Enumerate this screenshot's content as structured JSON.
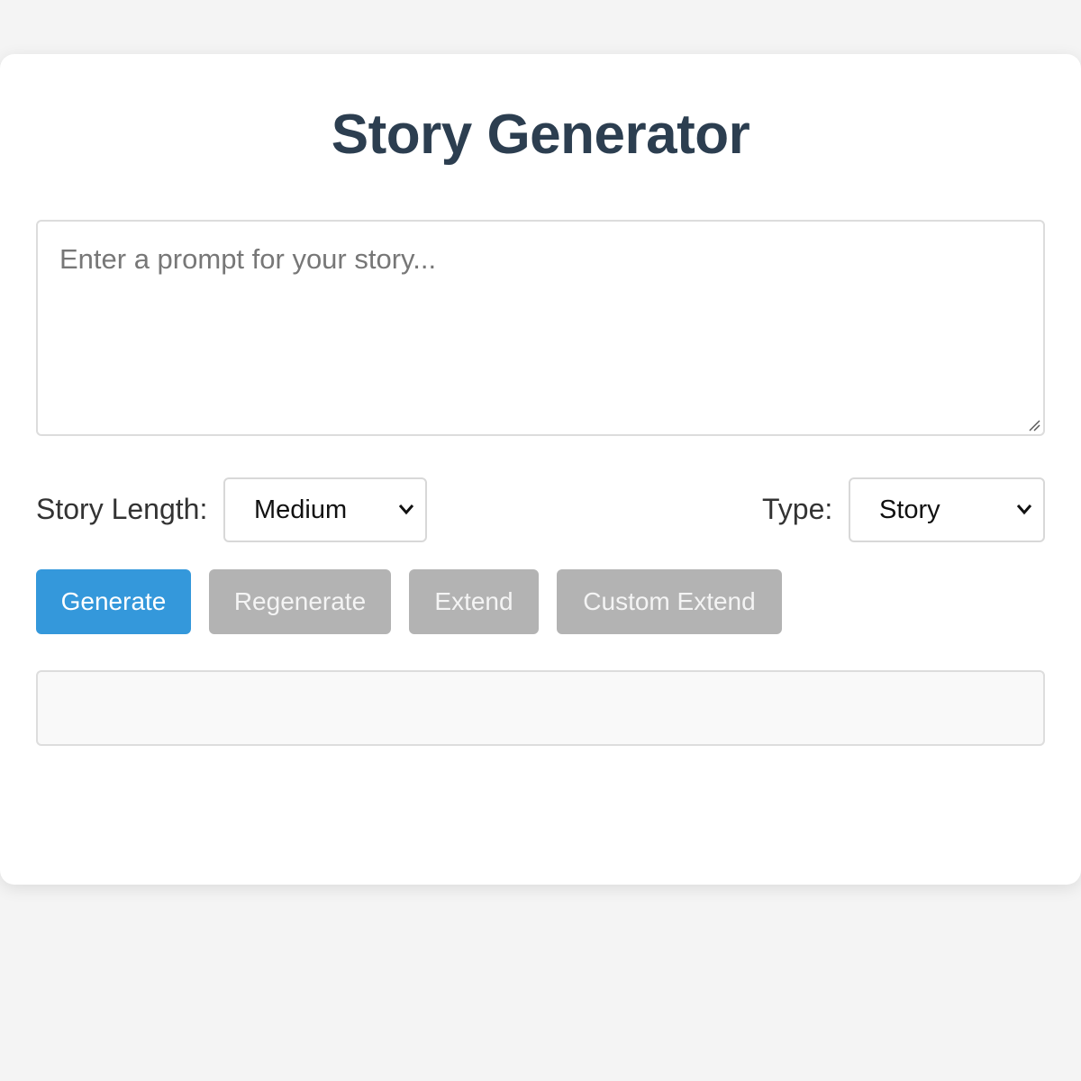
{
  "app": {
    "title": "Story Generator"
  },
  "prompt": {
    "placeholder": "Enter a prompt for your story...",
    "value": ""
  },
  "options": {
    "length_label": "Story Length:",
    "length_selected": "Medium",
    "type_label": "Type:",
    "type_selected": "Story"
  },
  "buttons": {
    "generate": "Generate",
    "regenerate": "Regenerate",
    "extend": "Extend",
    "custom_extend": "Custom Extend"
  },
  "output": {
    "text": ""
  },
  "colors": {
    "title": "#2c3e50",
    "primary": "#3498db",
    "disabled": "#b3b3b3",
    "background": "#f4f4f4"
  },
  "icons": {
    "select_arrow": "chevron-down-icon",
    "resize": "resize-handle-icon"
  }
}
